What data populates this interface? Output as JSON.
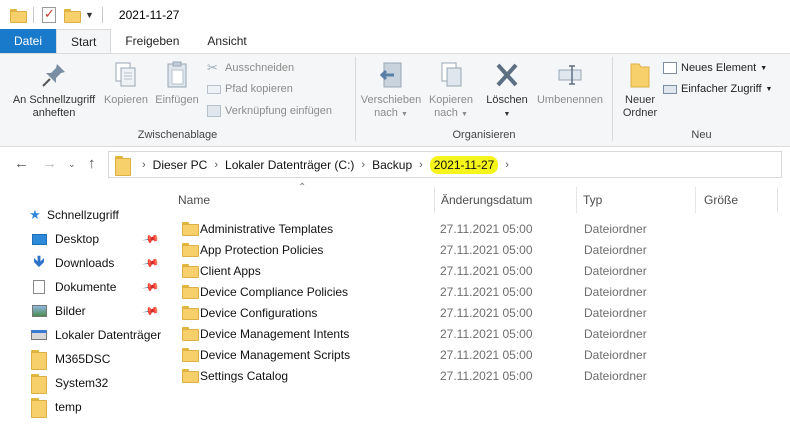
{
  "window": {
    "title": "2021-11-27"
  },
  "tabs": {
    "file": "Datei",
    "start": "Start",
    "share": "Freigeben",
    "view": "Ansicht"
  },
  "ribbon": {
    "clipboard": {
      "label": "Zwischenablage",
      "pin_quick_access": "An Schnellzugriff\nanheften",
      "pin_line1": "An Schnellzugriff",
      "pin_line2": "anheften",
      "copy": "Kopieren",
      "paste": "Einfügen",
      "cut": "Ausschneiden",
      "copy_path": "Pfad kopieren",
      "paste_shortcut": "Verknüpfung einfügen"
    },
    "organize": {
      "label": "Organisieren",
      "move_line1": "Verschieben",
      "move_line2": "nach",
      "copy_line1": "Kopieren",
      "copy_line2": "nach",
      "delete": "Löschen",
      "rename": "Umbenennen"
    },
    "new": {
      "label": "Neu",
      "new_folder_line1": "Neuer",
      "new_folder_line2": "Ordner",
      "new_item": "Neues Element",
      "easy_access": "Einfacher Zugriff"
    }
  },
  "address": {
    "crumbs": [
      "Dieser PC",
      "Lokaler Datenträger (C:)",
      "Backup",
      "2021-11-27"
    ],
    "highlight_color": "#f6f51b"
  },
  "columns": {
    "name": "Name",
    "date": "Änderungsdatum",
    "type": "Typ",
    "size": "Größe"
  },
  "sidebar": {
    "items": [
      {
        "label": "Schnellzugriff",
        "icon": "star-icon",
        "pinned": false
      },
      {
        "label": "Desktop",
        "icon": "desktop-icon",
        "pinned": true
      },
      {
        "label": "Downloads",
        "icon": "download-icon",
        "pinned": true
      },
      {
        "label": "Dokumente",
        "icon": "document-icon",
        "pinned": true
      },
      {
        "label": "Bilder",
        "icon": "pictures-icon",
        "pinned": true
      },
      {
        "label": "Lokaler Datenträger",
        "icon": "drive-icon",
        "pinned": false
      },
      {
        "label": "M365DSC",
        "icon": "folder-icon",
        "pinned": false
      },
      {
        "label": "System32",
        "icon": "folder-icon",
        "pinned": false
      },
      {
        "label": "temp",
        "icon": "folder-icon",
        "pinned": false
      }
    ]
  },
  "files": [
    {
      "name": "Administrative Templates",
      "date": "27.11.2021 05:00",
      "type": "Dateiordner"
    },
    {
      "name": "App Protection Policies",
      "date": "27.11.2021 05:00",
      "type": "Dateiordner"
    },
    {
      "name": "Client Apps",
      "date": "27.11.2021 05:00",
      "type": "Dateiordner"
    },
    {
      "name": "Device Compliance Policies",
      "date": "27.11.2021 05:00",
      "type": "Dateiordner"
    },
    {
      "name": "Device Configurations",
      "date": "27.11.2021 05:00",
      "type": "Dateiordner"
    },
    {
      "name": "Device Management Intents",
      "date": "27.11.2021 05:00",
      "type": "Dateiordner"
    },
    {
      "name": "Device Management Scripts",
      "date": "27.11.2021 05:00",
      "type": "Dateiordner"
    },
    {
      "name": "Settings Catalog",
      "date": "27.11.2021 05:00",
      "type": "Dateiordner"
    }
  ],
  "colors": {
    "file_tab": "#1979ca",
    "accent": "#1979ca",
    "folder": "#f7d06b"
  }
}
